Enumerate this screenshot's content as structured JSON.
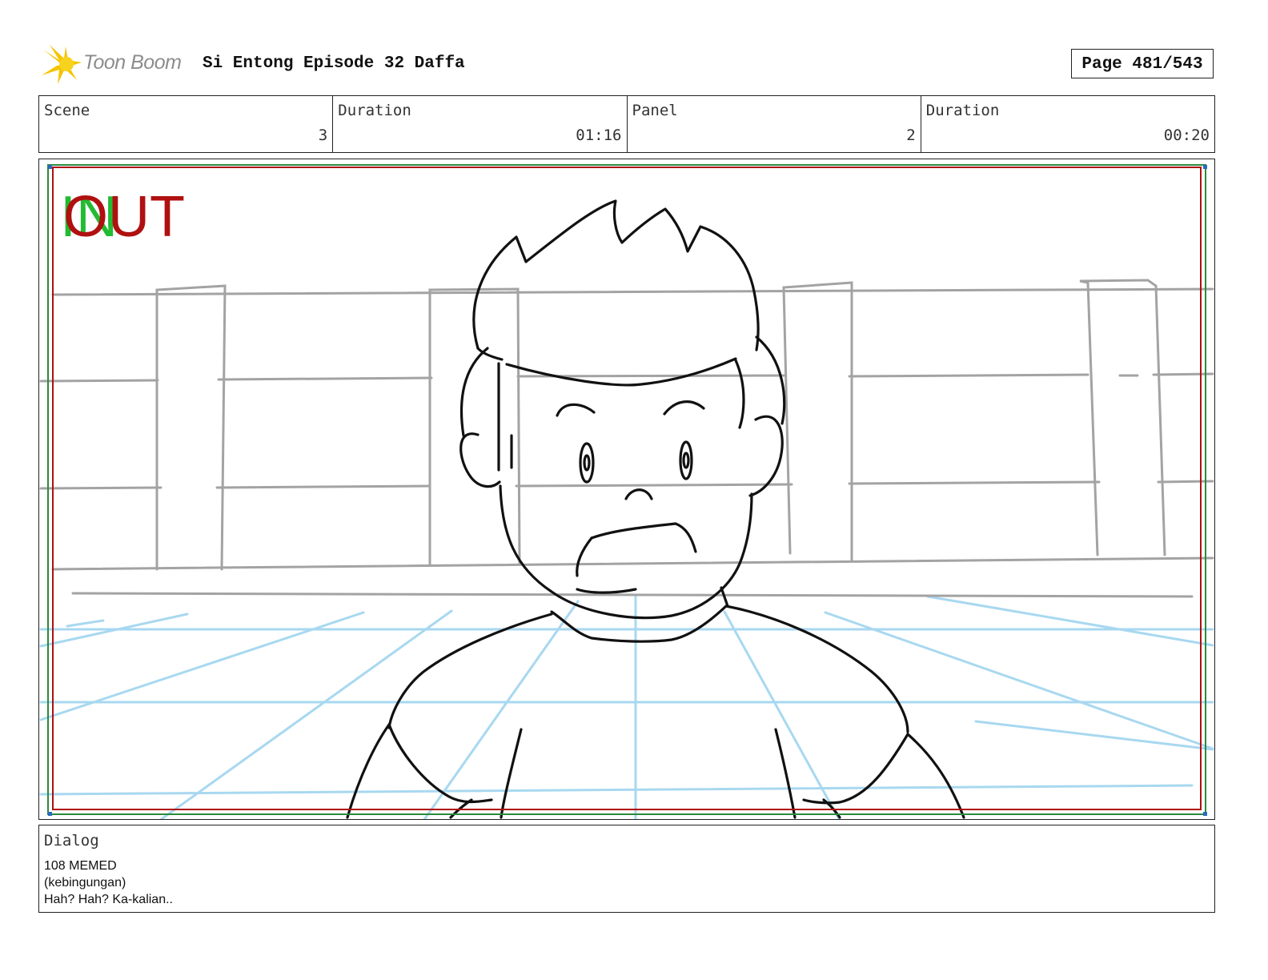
{
  "header": {
    "logo_text": "Toon Boom",
    "title": "Si Entong Episode 32 Daffa",
    "page_label": "Page 481/543"
  },
  "info": {
    "scene_label": "Scene",
    "scene_value": "3",
    "scene_duration_label": "Duration",
    "scene_duration_value": "01:16",
    "panel_label": "Panel",
    "panel_value": "2",
    "panel_duration_label": "Duration",
    "panel_duration_value": "00:20"
  },
  "panel_overlay": {
    "in_text": "IN",
    "out_text": "OUT",
    "in_color": "#22bb33",
    "out_color": "#b01010"
  },
  "dialog": {
    "label": "Dialog",
    "lines": [
      "108 MEMED",
      "(kebingungan)",
      "Hah? Hah? Ka-kalian.."
    ]
  }
}
